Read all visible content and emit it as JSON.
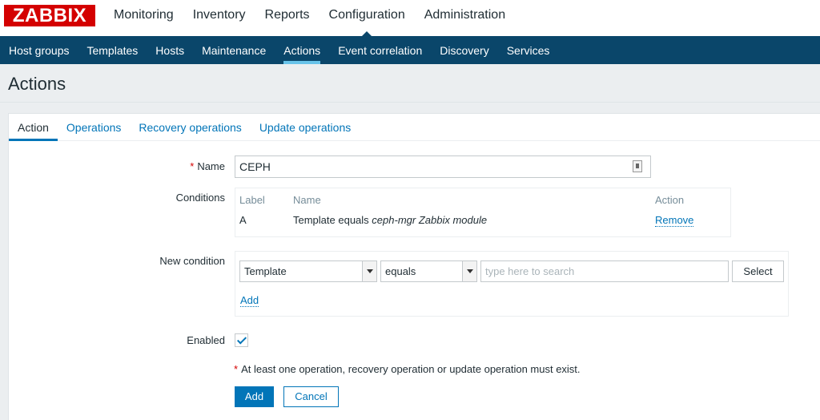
{
  "brand": {
    "logo_text": "ZABBIX",
    "accent": "#d40000",
    "nav_bg": "#0a466a",
    "link": "#0275b8"
  },
  "main_menu": [
    "Monitoring",
    "Inventory",
    "Reports",
    "Configuration",
    "Administration"
  ],
  "sub_menu": [
    "Host groups",
    "Templates",
    "Hosts",
    "Maintenance",
    "Actions",
    "Event correlation",
    "Discovery",
    "Services"
  ],
  "page": {
    "title": "Actions"
  },
  "tabs": [
    "Action",
    "Operations",
    "Recovery operations",
    "Update operations"
  ],
  "form": {
    "name_label": "Name",
    "name_value": "CEPH",
    "conditions_label": "Conditions",
    "conditions": {
      "headers": {
        "label": "Label",
        "name": "Name",
        "action": "Action"
      },
      "rows": [
        {
          "label": "A",
          "name_prefix": "Template equals",
          "name_value": "ceph-mgr Zabbix module",
          "action": "Remove"
        }
      ]
    },
    "new_condition_label": "New condition",
    "new_condition": {
      "type_value": "Template",
      "operator_value": "equals",
      "search_placeholder": "type here to search",
      "select_button": "Select",
      "add_link": "Add"
    },
    "enabled_label": "Enabled",
    "enabled": true,
    "note": "At least one operation, recovery operation or update operation must exist.",
    "add_button": "Add",
    "cancel_button": "Cancel"
  }
}
